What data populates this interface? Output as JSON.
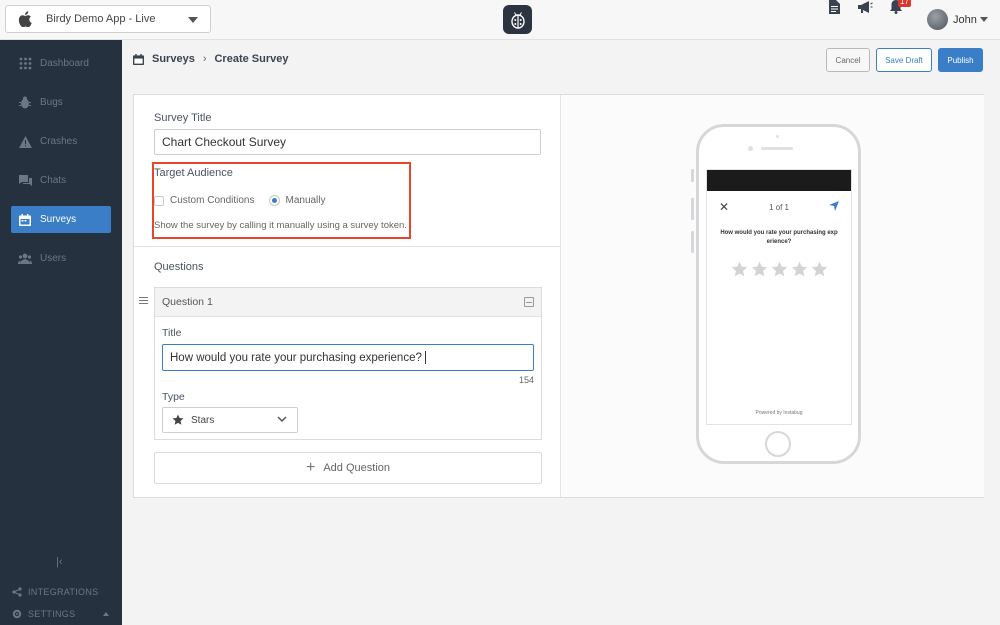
{
  "app": {
    "selected_app": "Birdy Demo App - Live",
    "notifications_count": "17",
    "user_name": "John"
  },
  "sidebar": {
    "items": [
      {
        "label": "Dashboard",
        "icon": "grid-icon",
        "active": false
      },
      {
        "label": "Bugs",
        "icon": "bug-icon",
        "active": false
      },
      {
        "label": "Crashes",
        "icon": "warning-icon",
        "active": false
      },
      {
        "label": "Chats",
        "icon": "chat-icon",
        "active": false
      },
      {
        "label": "Surveys",
        "icon": "calendar-icon",
        "active": true
      },
      {
        "label": "Users",
        "icon": "users-icon",
        "active": false
      }
    ],
    "integrations_label": "INTEGRATIONS",
    "settings_label": "SETTINGS"
  },
  "breadcrumb": {
    "parent": "Surveys",
    "current": "Create Survey"
  },
  "toolbar": {
    "cancel_label": "Cancel",
    "save_draft_label": "Save Draft",
    "publish_label": "Publish"
  },
  "form": {
    "survey_title_label": "Survey Title",
    "survey_title_value": "Chart Checkout Survey",
    "target_audience_label": "Target Audience",
    "custom_conditions_label": "Custom Conditions",
    "manually_label": "Manually",
    "target_hint": "Show the survey by calling it manually using a survey token.",
    "questions_label": "Questions",
    "question": {
      "header": "Question 1",
      "title_label": "Title",
      "title_value": "How would you rate your purchasing experience?",
      "char_count": "154",
      "type_label": "Type",
      "type_value": "Stars"
    },
    "add_question_label": "Add Question"
  },
  "preview": {
    "pager": "1 of 1",
    "question": "How would you rate your purchasing exp erience?",
    "stars_count": 5,
    "powered_by": "Powered by Instabug"
  },
  "colors": {
    "sidebar_bg": "#25313f",
    "accent": "#3b7ec8",
    "highlight_border": "#e8442e",
    "badge": "#d9372d"
  }
}
